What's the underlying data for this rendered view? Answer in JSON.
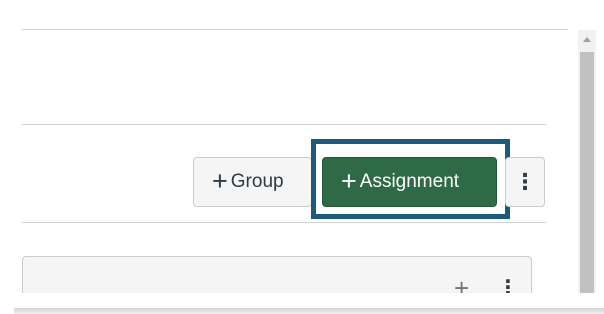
{
  "toolbar": {
    "group_button": {
      "icon": "plus-icon",
      "label": "Group"
    },
    "assignment_button": {
      "icon": "plus-icon",
      "label": "Assignment"
    },
    "more_options": {
      "icon": "kebab-icon",
      "glyph": "⋮"
    }
  },
  "assignment_group_row": {
    "add_icon": {
      "icon": "plus-icon",
      "glyph": "+"
    },
    "options_icon": {
      "icon": "kebab-icon",
      "glyph": "⋮"
    }
  },
  "colors": {
    "primary_button": "#2e6a45",
    "highlight_border": "#1a5a7a",
    "secondary_button": "#f5f5f5"
  }
}
